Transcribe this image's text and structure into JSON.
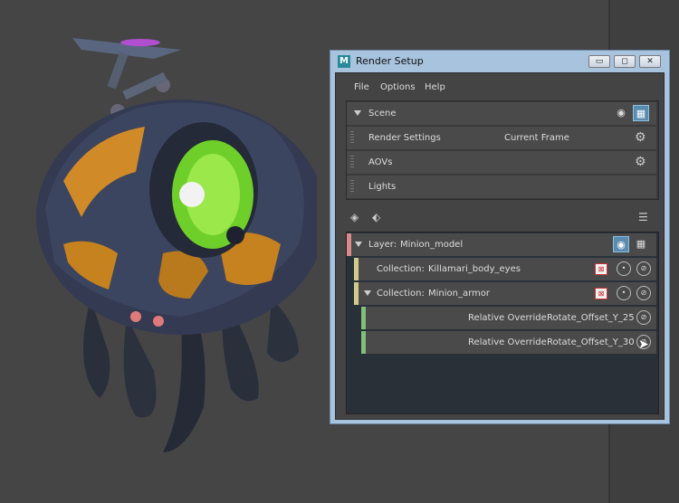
{
  "window": {
    "title": "Render Setup",
    "app_icon_letter": "M",
    "controls": {
      "minimize": "▭",
      "maximize": "◻",
      "close": "✕"
    }
  },
  "menu": [
    "File",
    "Options",
    "Help"
  ],
  "scene": {
    "label": "Scene",
    "items": [
      {
        "label": "Render Settings",
        "value": "Current Frame",
        "icon": "gear-icon"
      },
      {
        "label": "AOVs",
        "value": "",
        "icon": "gear-icon"
      },
      {
        "label": "Lights",
        "value": "",
        "icon": ""
      }
    ]
  },
  "layers": {
    "layer": {
      "prefix": "Layer:",
      "name": "Minion_model",
      "stripe_color": "#d98a8a"
    },
    "collections": [
      {
        "prefix": "Collection:",
        "name": "Killamari_body_eyes",
        "stripe_color": "#cfc98a",
        "expanded": false
      },
      {
        "prefix": "Collection:",
        "name": "Minion_armor",
        "stripe_color": "#cfc98a",
        "expanded": true
      }
    ],
    "overrides": [
      {
        "prefix": "Relative Override:",
        "name": "Rotate_Offset_Y_25",
        "stripe_color": "#7fc07a"
      },
      {
        "prefix": "Relative Override:",
        "name": "Rotate_Offset_Y_30",
        "stripe_color": "#7fc07a"
      }
    ]
  },
  "colors": {
    "accent_blue": "#5a8cb0",
    "title_bar": "#a8c3dd"
  }
}
